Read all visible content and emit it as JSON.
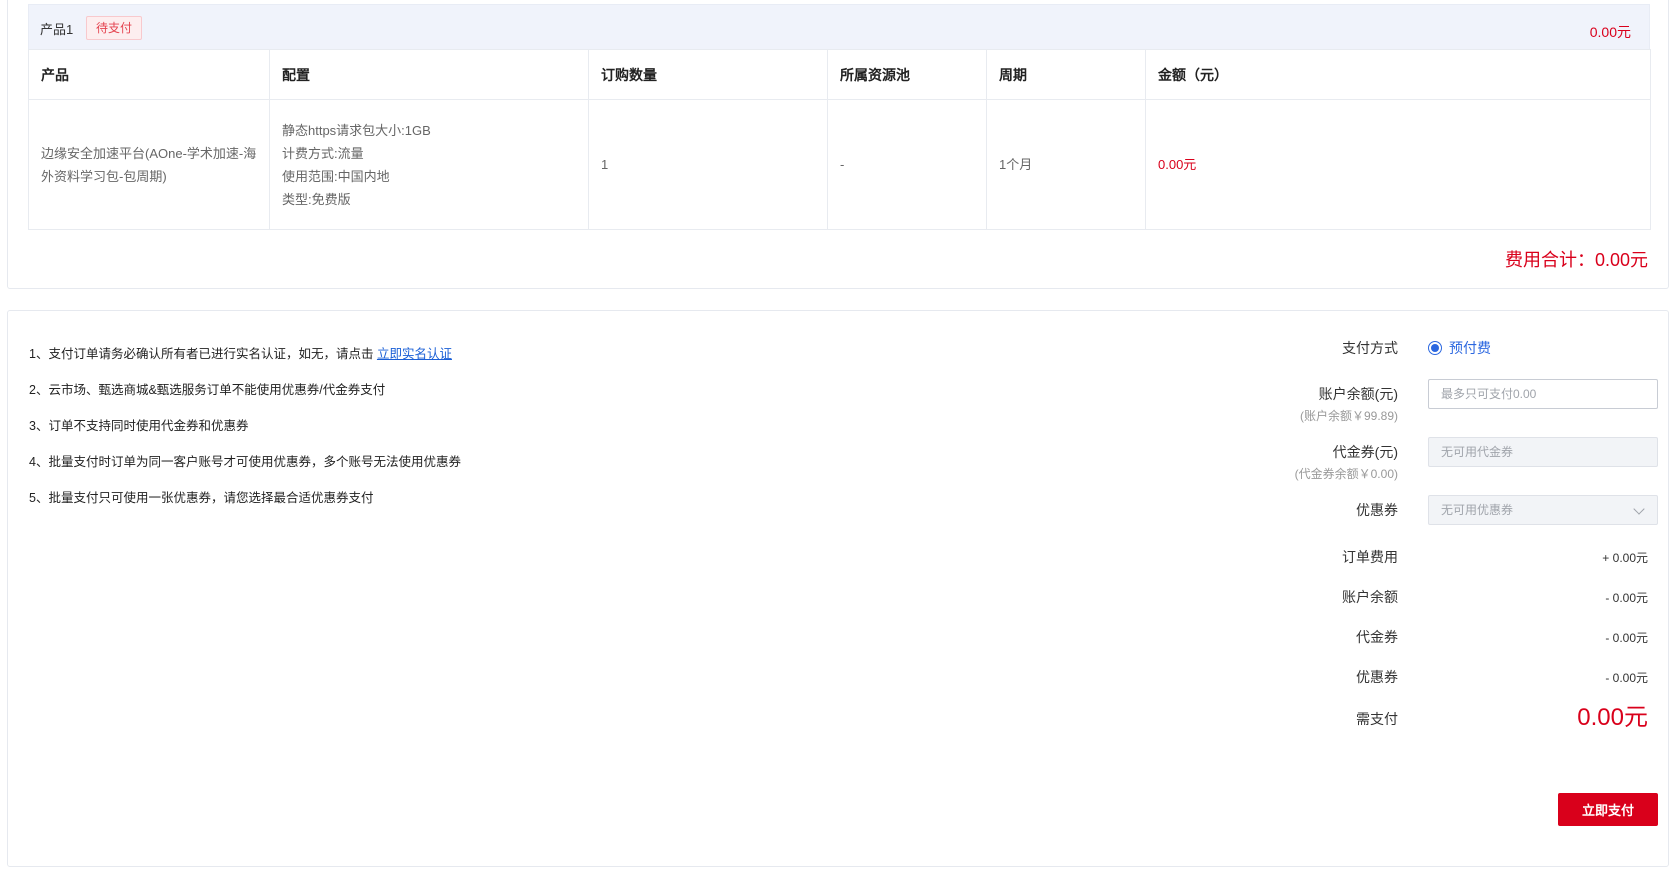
{
  "order": {
    "product_label": "产品1",
    "status_tag": "待支付",
    "band_amount": "0.00元",
    "headers": [
      "产品",
      "配置",
      "订购数量",
      "所属资源池",
      "周期",
      "金额（元）"
    ],
    "row": {
      "product": "边缘安全加速平台(AOne-学术加速-海外资料学习包-包周期)",
      "config": [
        "静态https请求包大小:1GB",
        "计费方式:流量",
        "使用范围:中国内地",
        "类型:免费版"
      ],
      "quantity": "1",
      "resource_pool": "-",
      "period": "1个月",
      "amount": "0.00元"
    },
    "total": "费用合计：0.00元"
  },
  "notes": {
    "n1_text": "1、支付订单请务必确认所有者已进行实名认证，如无，请点击 ",
    "n1_link": "立即实名认证",
    "n2": "2、云市场、甄选商城&甄选服务订单不能使用优惠券/代金券支付",
    "n3": "3、订单不支持同时使用代金券和优惠券",
    "n4": "4、批量支付时订单为同一客户账号才可使用优惠券，多个账号无法使用优惠券",
    "n5": "5、批量支付只可使用一张优惠券，请您选择最合适优惠券支付"
  },
  "payment": {
    "method_label": "支付方式",
    "method_option": "预付费",
    "balance_label": "账户余额(元)",
    "balance_sub": "(账户余额￥99.89)",
    "balance_placeholder": "最多只可支付0.00",
    "voucher_label": "代金券(元)",
    "voucher_sub": "(代金券余额￥0.00)",
    "voucher_placeholder": "无可用代金券",
    "coupon_label": "优惠券",
    "coupon_value": "无可用优惠券",
    "summary": [
      {
        "label": "订单费用",
        "value": "+ 0.00元"
      },
      {
        "label": "账户余额",
        "value": "- 0.00元"
      },
      {
        "label": "代金券",
        "value": "- 0.00元"
      },
      {
        "label": "优惠券",
        "value": "- 0.00元"
      }
    ],
    "need_pay_label": "需支付",
    "need_pay_value": "0.00元",
    "pay_button": "立即支付"
  },
  "colors": {
    "accent_red": "#d9001b",
    "link_blue": "#1a5fd6",
    "radio_blue": "#2b67e0"
  }
}
